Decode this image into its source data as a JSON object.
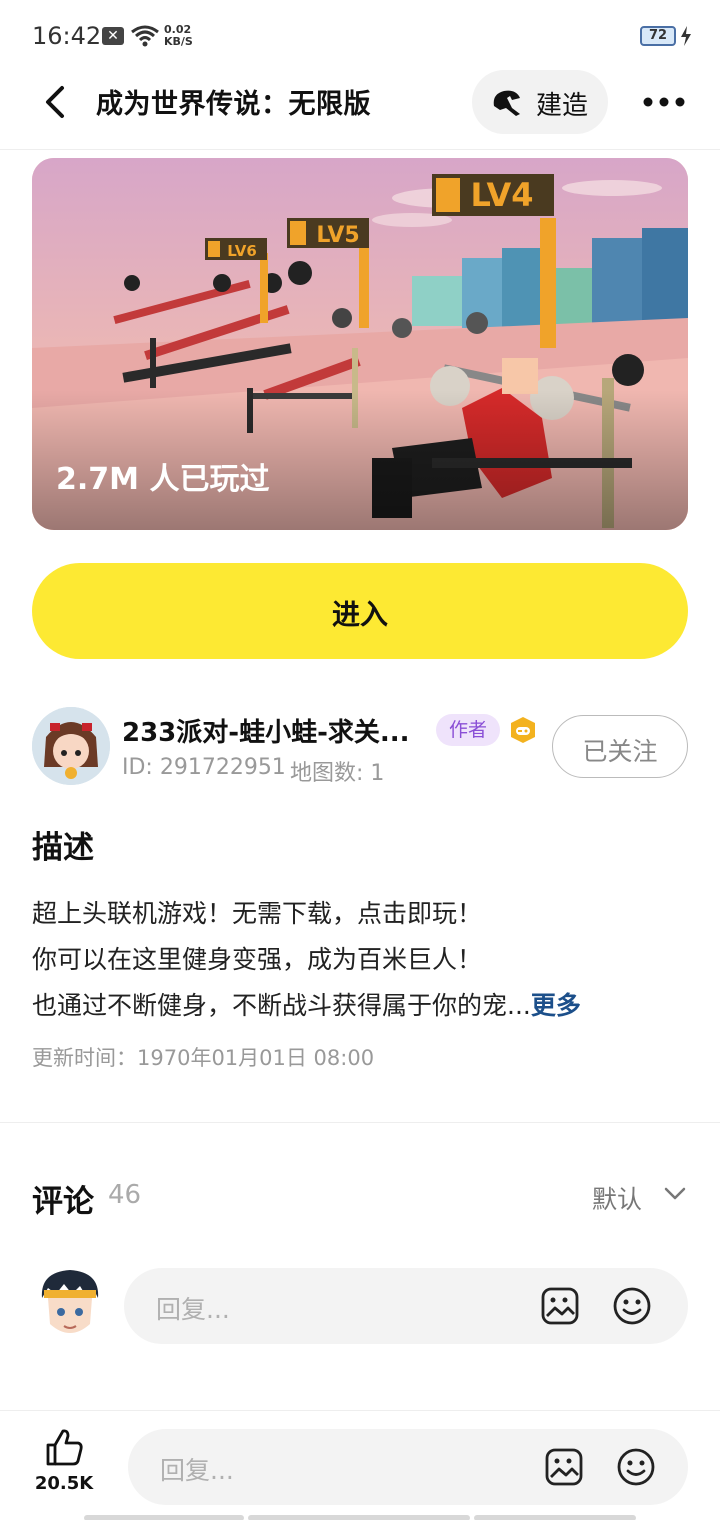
{
  "status_bar": {
    "time": "16:42",
    "speed_value": "0.02",
    "speed_unit": "KB/S",
    "battery": "72"
  },
  "header": {
    "title": "成为世界传说：无限版",
    "build_label": "建造",
    "icons": [
      "back-icon",
      "build-icon",
      "more-icon"
    ]
  },
  "banner": {
    "played_text": "2.7M 人已玩过",
    "signs": [
      "LV4",
      "LV5",
      "LV6"
    ]
  },
  "enter_button": {
    "label": "进入"
  },
  "author": {
    "name": "233派对-蛙小蛙-求关...",
    "badge": "作者",
    "id_text": "ID: 291722951",
    "maps_text": "地图数: 1",
    "follow_label": "已关注"
  },
  "description": {
    "title": "描述",
    "lines": [
      "超上头联机游戏！无需下载，点击即玩！",
      "你可以在这里健身变强，成为百米巨人！",
      "也通过不断健身，不断战斗获得属于你的宠..."
    ],
    "more_label": "更多",
    "update_time": "更新时间：1970年01月01日 08:00"
  },
  "comments": {
    "title": "评论",
    "count": "46",
    "sort_label": "默认",
    "reply_placeholder": "回复..."
  },
  "bottom_bar": {
    "like_count": "20.5K",
    "reply_placeholder": "回复..."
  },
  "colors": {
    "accent_yellow": "#fde933",
    "badge_purple": "#8a4fd6",
    "more_link_blue": "#1c4f8a"
  }
}
